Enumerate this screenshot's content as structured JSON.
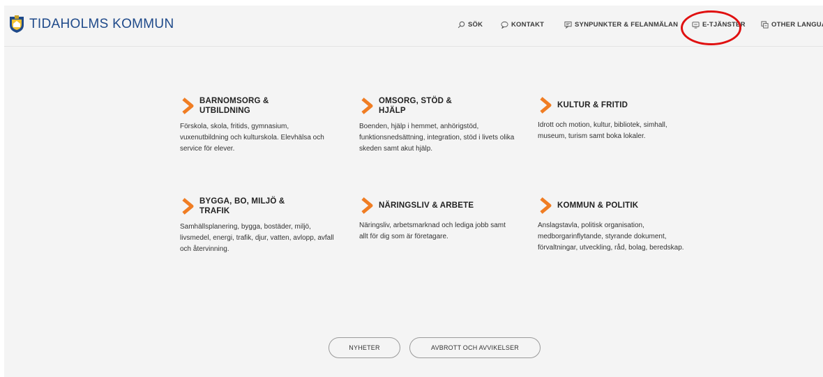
{
  "header": {
    "logo_text": "TIDAHOLMS KOMMUN",
    "nav": [
      {
        "label": "SÖK",
        "icon": "search-icon"
      },
      {
        "label": "KONTAKT",
        "icon": "chat-bubble-icon"
      },
      {
        "label": "SYNPUNKTER & FELANMÄLAN",
        "icon": "feedback-icon"
      },
      {
        "label": "E-TJÄNSTER",
        "icon": "monitor-icon"
      },
      {
        "label": "OTHER LANGUAG",
        "icon": "translate-icon"
      }
    ]
  },
  "categories": [
    {
      "title": "BARNOMSORG & UTBILDNING",
      "description": "Förskola, skola, fritids, gymnasium, vuxenutbildning och kulturskola. Elevhälsa och service för elever."
    },
    {
      "title": "OMSORG, STÖD & HJÄLP",
      "description": "Boenden, hjälp i hemmet, anhörigstöd, funktionsnedsättning, integration, stöd i livets olika skeden samt akut hjälp."
    },
    {
      "title": "KULTUR & FRITID",
      "description": "Idrott och motion, kultur, bibliotek, simhall, museum, turism samt boka lokaler."
    },
    {
      "title": "BYGGA, BO, MILJÖ & TRAFIK",
      "description": "Samhällsplanering, bygga, bostäder, miljö, livsmedel, energi, trafik, djur, vatten, avlopp, avfall och återvinning."
    },
    {
      "title": "NÄRINGSLIV & ARBETE",
      "description": "Näringsliv, arbetsmarknad och lediga jobb samt allt för dig som är företagare."
    },
    {
      "title": "KOMMUN & POLITIK",
      "description": "Anslagstavla, politisk organisation, medborgarinflytande, styrande dokument, förvaltningar, utveckling, råd, bolag, beredskap."
    }
  ],
  "buttons": {
    "news": "NYHETER",
    "outages": "AVBROTT OCH AVVIKELSER"
  },
  "colors": {
    "accent_orange": "#f07d23",
    "highlight_red": "#e01010",
    "logo_blue": "#1f4a8a",
    "page_bg": "#f4f4f4"
  }
}
